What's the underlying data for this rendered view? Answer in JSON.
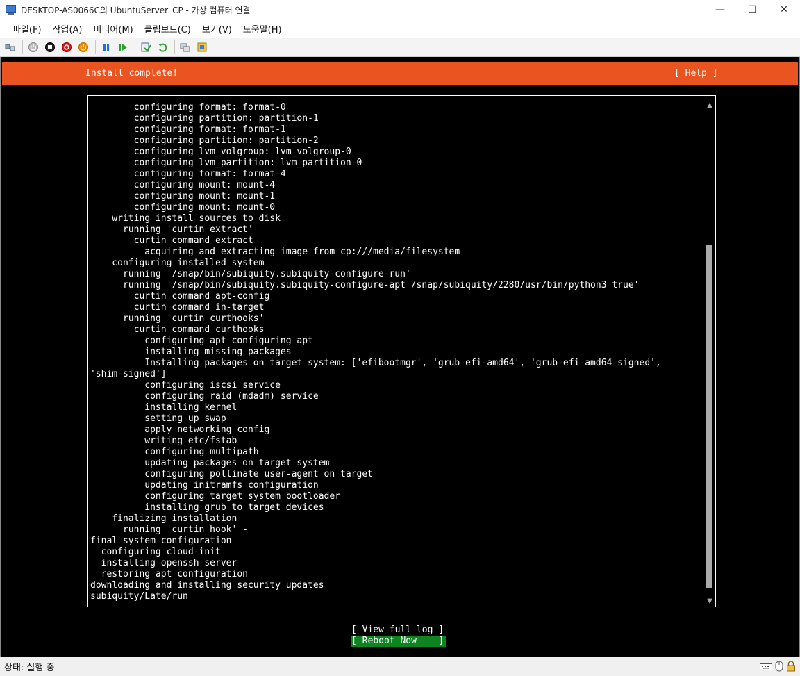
{
  "window": {
    "title": "DESKTOP-AS0066C의 UbuntuServer_CP - 가상 컴퓨터 연결",
    "minimize": "—",
    "maximize": "☐",
    "close": "✕"
  },
  "menu": [
    "파일(F)",
    "작업(A)",
    "미디어(M)",
    "클립보드(C)",
    "보기(V)",
    "도움말(H)"
  ],
  "toolbar": {
    "icons": [
      "ctrl-alt-del-icon",
      "start-icon",
      "turn-off-icon",
      "shutdown-icon",
      "power-icon",
      "pause-icon",
      "resume-icon",
      "checkpoint-icon",
      "revert-icon",
      "enhanced-session-icon",
      "share-icon"
    ]
  },
  "installer": {
    "header_title": "Install complete!",
    "help": "[ Help ]",
    "log_lines": [
      "        configuring format: format-0",
      "        configuring partition: partition-1",
      "        configuring format: format-1",
      "        configuring partition: partition-2",
      "        configuring lvm_volgroup: lvm_volgroup-0",
      "        configuring lvm_partition: lvm_partition-0",
      "        configuring format: format-4",
      "        configuring mount: mount-4",
      "        configuring mount: mount-1",
      "        configuring mount: mount-0",
      "    writing install sources to disk",
      "      running 'curtin extract'",
      "        curtin command extract",
      "          acquiring and extracting image from cp:///media/filesystem",
      "    configuring installed system",
      "      running '/snap/bin/subiquity.subiquity-configure-run'",
      "      running '/snap/bin/subiquity.subiquity-configure-apt /snap/subiquity/2280/usr/bin/python3 true'",
      "        curtin command apt-config",
      "        curtin command in-target",
      "      running 'curtin curthooks'",
      "        curtin command curthooks",
      "          configuring apt configuring apt",
      "          installing missing packages",
      "          Installing packages on target system: ['efibootmgr', 'grub-efi-amd64', 'grub-efi-amd64-signed',",
      "'shim-signed']",
      "          configuring iscsi service",
      "          configuring raid (mdadm) service",
      "          installing kernel",
      "          setting up swap",
      "          apply networking config",
      "          writing etc/fstab",
      "          configuring multipath",
      "          updating packages on target system",
      "          configuring pollinate user-agent on target",
      "          updating initramfs configuration",
      "          configuring target system bootloader",
      "          installing grub to target devices",
      "    finalizing installation",
      "      running 'curtin hook' -",
      "final system configuration",
      "  configuring cloud-init",
      "  installing openssh-server",
      "  restoring apt configuration",
      "downloading and installing security updates",
      "subiquity/Late/run"
    ],
    "view_log_button": "[ View full log ]",
    "reboot_button": "[ Reboot Now    ]",
    "colors": {
      "header": "#e95420",
      "reboot_button": "#0e8420",
      "background": "#000000"
    }
  },
  "status": {
    "text": "상태: 실행 중"
  }
}
